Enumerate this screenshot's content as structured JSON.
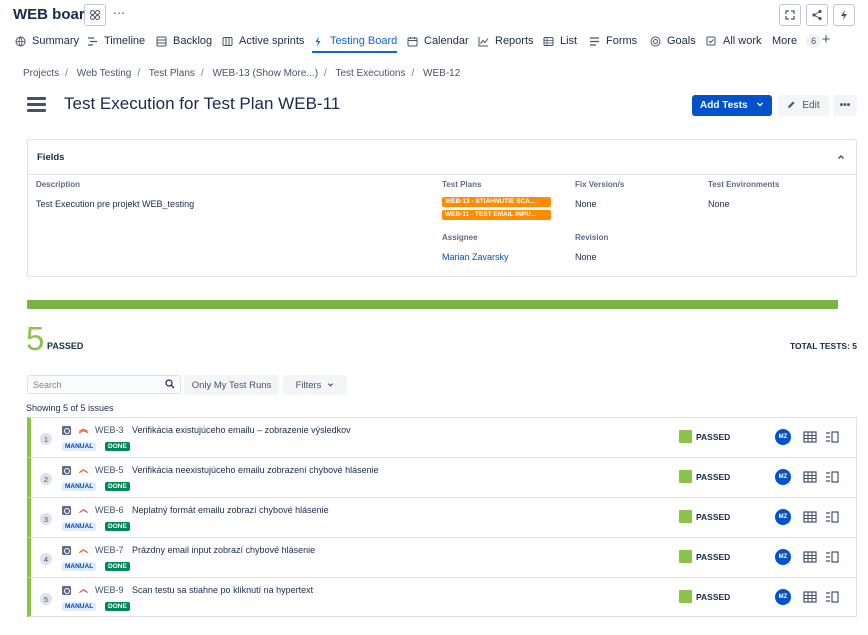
{
  "app": {
    "title": "WEB board"
  },
  "tabs": [
    {
      "label": "Summary",
      "icon": "globe-icon"
    },
    {
      "label": "Timeline",
      "icon": "timeline-icon"
    },
    {
      "label": "Backlog",
      "icon": "backlog-icon"
    },
    {
      "label": "Active sprints",
      "icon": "board-icon"
    },
    {
      "label": "Testing Board",
      "icon": "bolt-icon",
      "active": true
    },
    {
      "label": "Calendar",
      "icon": "calendar-icon"
    },
    {
      "label": "Reports",
      "icon": "chart-icon"
    },
    {
      "label": "List",
      "icon": "list-icon"
    },
    {
      "label": "Forms",
      "icon": "forms-icon"
    },
    {
      "label": "Goals",
      "icon": "target-icon"
    },
    {
      "label": "All work",
      "icon": "checklist-icon"
    }
  ],
  "more": {
    "label": "More",
    "count": "6"
  },
  "breadcrumb": [
    "Projects",
    "Web Testing",
    "Test Plans",
    "WEB-13 (Show More...)",
    "Test Executions",
    "WEB-12"
  ],
  "page": {
    "title": "Test Execution for Test Plan WEB-11",
    "add_tests_label": "Add Tests",
    "edit_label": "Edit"
  },
  "fields": {
    "title": "Fields",
    "description_label": "Description",
    "description_value": "Test Execution pre projekt WEB_testing",
    "test_plans_label": "Test Plans",
    "test_plans": [
      "WEB-13 - STIAHNUTIE SCA...",
      "WEB-11 - TEST EMAIL INPU..."
    ],
    "fix_version_label": "Fix Version/s",
    "fix_version_value": "None",
    "test_env_label": "Test Environments",
    "test_env_value": "None",
    "assignee_label": "Assignee",
    "assignee_value": "Marian Zavarsky",
    "revision_label": "Revision",
    "revision_value": "None"
  },
  "summary": {
    "passed_count": "5",
    "passed_label": "PASSED",
    "total_label": "TOTAL TESTS: 5",
    "progress_passed_fraction": 1.0,
    "colors": {
      "passed": "#8bc34a",
      "primary": "#0052cc",
      "done": "#00875a",
      "tag_orange": "#ff8b00"
    }
  },
  "filters": {
    "search_placeholder": "Search",
    "my_runs_label": "Only My Test Runs",
    "filters_label": "Filters",
    "showing_text": "Showing 5 of 5 issues"
  },
  "tests": [
    {
      "index": "1",
      "key": "WEB-3",
      "summary": "Verifikácia existujúceho emailu – zobrazenie výsledkov",
      "type_tag": "MANUAL",
      "status_tag": "DONE",
      "result": "PASSED",
      "assignee": "MZ",
      "priority": "high"
    },
    {
      "index": "2",
      "key": "WEB-5",
      "summary": "Verifikácia neexistujúceho emailu zobrazení chybové hlásenie",
      "type_tag": "MANUAL",
      "status_tag": "DONE",
      "result": "PASSED",
      "assignee": "MZ",
      "priority": "medium"
    },
    {
      "index": "3",
      "key": "WEB-6",
      "summary": "Neplatný formát emailu zobrazí chybové hlásenie",
      "type_tag": "MANUAL",
      "status_tag": "DONE",
      "result": "PASSED",
      "assignee": "MZ",
      "priority": "medium"
    },
    {
      "index": "4",
      "key": "WEB-7",
      "summary": "Prázdny email input zobrazí chybové hlásenie",
      "type_tag": "MANUAL",
      "status_tag": "DONE",
      "result": "PASSED",
      "assignee": "MZ",
      "priority": "medium"
    },
    {
      "index": "5",
      "key": "WEB-9",
      "summary": "Scan testu sa stiahne po kliknutí na hypertext",
      "type_tag": "MANUAL",
      "status_tag": "DONE",
      "result": "PASSED",
      "assignee": "MZ",
      "priority": "medium"
    }
  ]
}
